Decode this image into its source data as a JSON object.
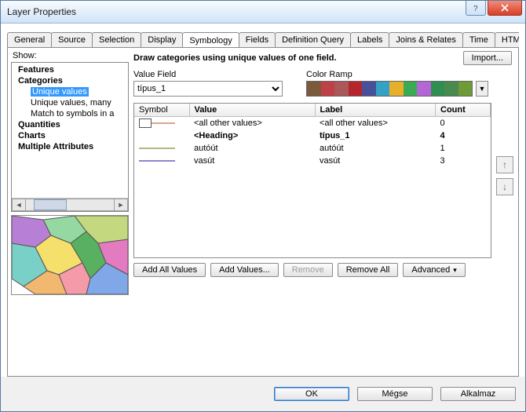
{
  "window": {
    "title": "Layer Properties"
  },
  "tabs": [
    "General",
    "Source",
    "Selection",
    "Display",
    "Symbology",
    "Fields",
    "Definition Query",
    "Labels",
    "Joins & Relates",
    "Time",
    "HTML Popup"
  ],
  "active_tab_index": 4,
  "show_label": "Show:",
  "tree": {
    "features": "Features",
    "categories": "Categories",
    "categories_children": [
      "Unique values",
      "Unique values, many",
      "Match to symbols in a"
    ],
    "selected_index": 0,
    "quantities": "Quantities",
    "charts": "Charts",
    "multiple": "Multiple Attributes"
  },
  "right": {
    "instruction": "Draw categories using unique values of one field.",
    "import_btn": "Import...",
    "value_field_label": "Value Field",
    "value_field": "típus_1",
    "color_ramp_label": "Color Ramp",
    "color_ramp_colors": [
      "#7a5a3a",
      "#c04048",
      "#aa585a",
      "#b4252e",
      "#4a4f9a",
      "#34a2c5",
      "#e8b02a",
      "#3aaa55",
      "#b565d6",
      "#2f8f50",
      "#4a8a4e",
      "#6e9a38"
    ]
  },
  "grid": {
    "headers": {
      "symbol": "Symbol",
      "value": "Value",
      "label": "Label",
      "count": "Count"
    },
    "rows": [
      {
        "sym_type": "box",
        "sym_color": "#ffffff",
        "value": "<all other values>",
        "label": "<all other values>",
        "count": "0",
        "bold": false
      },
      {
        "sym_type": "none",
        "sym_color": "",
        "value": "<Heading>",
        "label": "típus_1",
        "count": "4",
        "bold": true
      },
      {
        "sym_type": "line",
        "sym_color": "#9aa050",
        "value": "autóút",
        "label": "autóút",
        "count": "1",
        "bold": false
      },
      {
        "sym_type": "line",
        "sym_color": "#6a5fbf",
        "value": "vasút",
        "label": "vasút",
        "count": "3",
        "bold": false
      }
    ]
  },
  "action_buttons": {
    "add_all": "Add All Values",
    "add": "Add Values...",
    "remove": "Remove",
    "remove_all": "Remove All",
    "advanced": "Advanced"
  },
  "footer": {
    "ok": "OK",
    "cancel": "Mégse",
    "apply": "Alkalmaz"
  }
}
